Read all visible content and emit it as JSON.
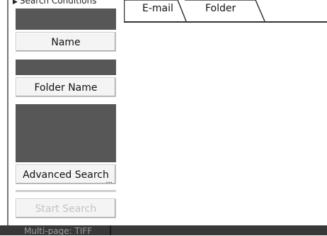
{
  "search_conditions": {
    "title": "Search Conditions",
    "name_button": "Name",
    "folder_name_button": "Folder Name",
    "advanced_search_button": "Advanced Search",
    "advanced_search_suffix": "...",
    "start_search_button": "Start Search"
  },
  "tabs": [
    {
      "label": "E-mail",
      "selected": false
    },
    {
      "label": "Folder",
      "selected": true
    }
  ],
  "status_bar": {
    "format_text": "Multi-page: TIFF"
  },
  "colors": {
    "field_box": "#575757",
    "status_bar": "#383838",
    "button_face": "#f4f4f4",
    "disabled_text": "#c3c3c3"
  }
}
